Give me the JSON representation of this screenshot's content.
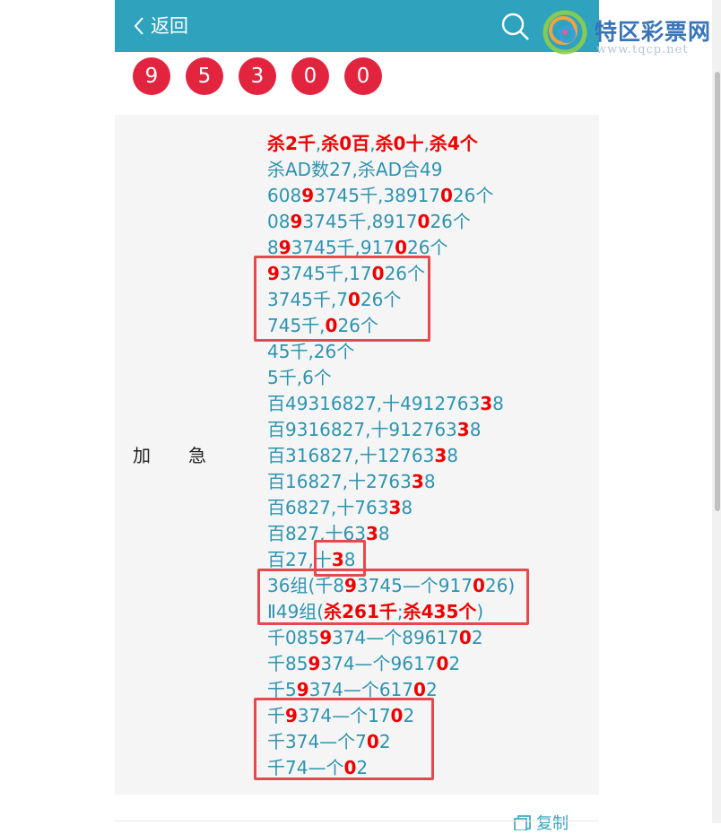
{
  "header": {
    "back_label": "返回",
    "logo_name": "特区彩票网",
    "logo_url": "www.tqcp.net"
  },
  "draw_numbers": [
    "9",
    "5",
    "3",
    "0",
    "0"
  ],
  "section_label": [
    "加",
    "急"
  ],
  "prediction_lines": [
    [
      {
        "t": "杀2千",
        "r": true
      },
      {
        "t": ",",
        "r": false
      },
      {
        "t": "杀0百",
        "r": true
      },
      {
        "t": ",",
        "r": false
      },
      {
        "t": "杀0十",
        "r": true
      },
      {
        "t": ",",
        "r": false
      },
      {
        "t": "杀4个",
        "r": true
      }
    ],
    [
      {
        "t": "杀AD数27,杀AD合49",
        "r": false
      }
    ],
    [
      {
        "t": "608",
        "r": false
      },
      {
        "t": "9",
        "r": true
      },
      {
        "t": "3745千,38917",
        "r": false
      },
      {
        "t": "0",
        "r": true
      },
      {
        "t": "26个",
        "r": false
      }
    ],
    [
      {
        "t": "08",
        "r": false
      },
      {
        "t": "9",
        "r": true
      },
      {
        "t": "3745千,8917",
        "r": false
      },
      {
        "t": "0",
        "r": true
      },
      {
        "t": "26个",
        "r": false
      }
    ],
    [
      {
        "t": "8",
        "r": false
      },
      {
        "t": "9",
        "r": true
      },
      {
        "t": "3745千,917",
        "r": false
      },
      {
        "t": "0",
        "r": true
      },
      {
        "t": "26个",
        "r": false
      }
    ],
    [
      {
        "t": "9",
        "r": true
      },
      {
        "t": "3745千,17",
        "r": false
      },
      {
        "t": "0",
        "r": true
      },
      {
        "t": "26个",
        "r": false
      }
    ],
    [
      {
        "t": "3745千,7",
        "r": false
      },
      {
        "t": "0",
        "r": true
      },
      {
        "t": "26个",
        "r": false
      }
    ],
    [
      {
        "t": "745千,",
        "r": false
      },
      {
        "t": "0",
        "r": true
      },
      {
        "t": "26个",
        "r": false
      }
    ],
    [
      {
        "t": "45千,26个",
        "r": false
      }
    ],
    [
      {
        "t": "5千,6个",
        "r": false
      }
    ],
    [
      {
        "t": "百49316827,十4912763",
        "r": false
      },
      {
        "t": "3",
        "r": true
      },
      {
        "t": "8",
        "r": false
      }
    ],
    [
      {
        "t": "百9316827,十912763",
        "r": false
      },
      {
        "t": "3",
        "r": true
      },
      {
        "t": "8",
        "r": false
      }
    ],
    [
      {
        "t": "百316827,十12763",
        "r": false
      },
      {
        "t": "3",
        "r": true
      },
      {
        "t": "8",
        "r": false
      }
    ],
    [
      {
        "t": "百16827,十2763",
        "r": false
      },
      {
        "t": "3",
        "r": true
      },
      {
        "t": "8",
        "r": false
      }
    ],
    [
      {
        "t": "百6827,十763",
        "r": false
      },
      {
        "t": "3",
        "r": true
      },
      {
        "t": "8",
        "r": false
      }
    ],
    [
      {
        "t": "百827,十63",
        "r": false
      },
      {
        "t": "3",
        "r": true
      },
      {
        "t": "8",
        "r": false
      }
    ],
    [
      {
        "t": "百27,十",
        "r": false
      },
      {
        "t": "3",
        "r": true
      },
      {
        "t": "8",
        "r": false
      }
    ],
    [
      {
        "t": "36组(千8",
        "r": false
      },
      {
        "t": "9",
        "r": true
      },
      {
        "t": "3745—个917",
        "r": false
      },
      {
        "t": "0",
        "r": true
      },
      {
        "t": "26)",
        "r": false
      }
    ],
    [
      {
        "t": "Ⅱ49组(",
        "r": false
      },
      {
        "t": "杀261千",
        "r": true
      },
      {
        "t": ";",
        "r": false
      },
      {
        "t": "杀435个",
        "r": true
      },
      {
        "t": ")",
        "r": false
      }
    ],
    [
      {
        "t": "千085",
        "r": false
      },
      {
        "t": "9",
        "r": true
      },
      {
        "t": "374—个89617",
        "r": false
      },
      {
        "t": "0",
        "r": true
      },
      {
        "t": "2",
        "r": false
      }
    ],
    [
      {
        "t": "千85",
        "r": false
      },
      {
        "t": "9",
        "r": true
      },
      {
        "t": "374—个9617",
        "r": false
      },
      {
        "t": "0",
        "r": true
      },
      {
        "t": "2",
        "r": false
      }
    ],
    [
      {
        "t": "千5",
        "r": false
      },
      {
        "t": "9",
        "r": true
      },
      {
        "t": "374—个617",
        "r": false
      },
      {
        "t": "0",
        "r": true
      },
      {
        "t": "2",
        "r": false
      }
    ],
    [
      {
        "t": "千",
        "r": false
      },
      {
        "t": "9",
        "r": true
      },
      {
        "t": "374—个17",
        "r": false
      },
      {
        "t": "0",
        "r": true
      },
      {
        "t": "2",
        "r": false
      }
    ],
    [
      {
        "t": "千374—个7",
        "r": false
      },
      {
        "t": "0",
        "r": true
      },
      {
        "t": "2",
        "r": false
      }
    ],
    [
      {
        "t": "千74—个",
        "r": false
      },
      {
        "t": "0",
        "r": true
      },
      {
        "t": "2",
        "r": false
      }
    ]
  ],
  "copy_label": "复制",
  "colors": {
    "header_bg": "#2fa3bd",
    "ball_red": "#e3243f",
    "text_blue": "#2d93b0",
    "highlight_red": "#ee0000",
    "box_red": "#e8484c"
  }
}
